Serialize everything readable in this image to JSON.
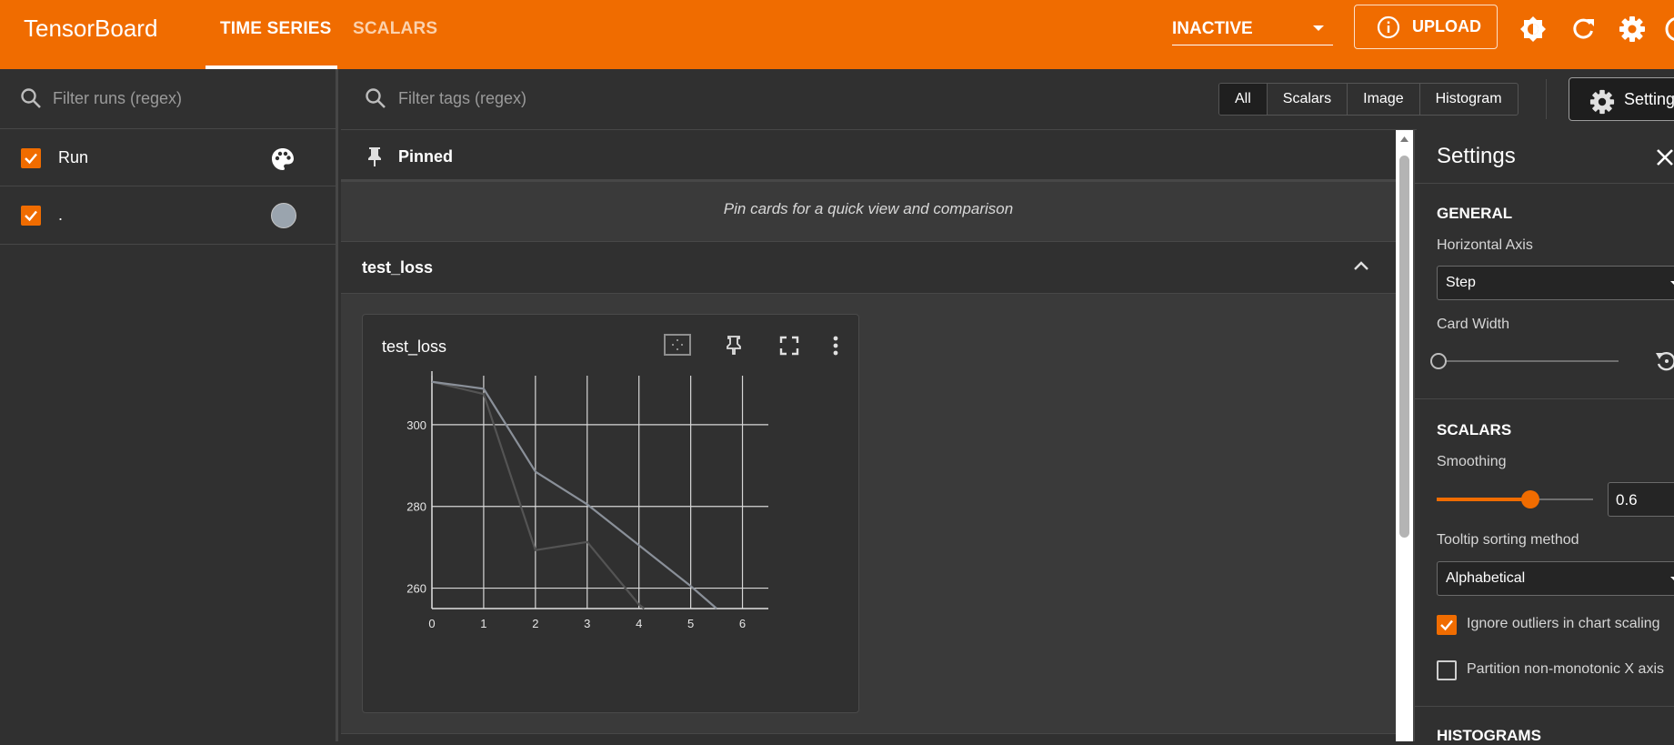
{
  "header": {
    "brand": "TensorBoard",
    "tabs": [
      {
        "label": "TIME SERIES",
        "active": true
      },
      {
        "label": "SCALARS",
        "active": false
      }
    ],
    "reload_selector": "INACTIVE",
    "upload_label": "UPLOAD",
    "accent_color": "#f06c00"
  },
  "runs_panel": {
    "filter_placeholder": "Filter runs (regex)",
    "items": [
      {
        "label": "Run",
        "checked": true,
        "icon": "palette-icon"
      },
      {
        "label": ".",
        "checked": true,
        "color": "#9aa4ae"
      }
    ]
  },
  "main": {
    "filter_placeholder": "Filter tags (regex)",
    "type_filters": [
      "All",
      "Scalars",
      "Image",
      "Histogram"
    ],
    "settings_button": "Settings",
    "pinned": {
      "title": "Pinned",
      "message": "Pin cards for a quick view and comparison"
    },
    "group": {
      "title": "test_loss"
    },
    "card": {
      "title": "test_loss"
    }
  },
  "chart_data": {
    "type": "line",
    "title": "test_loss",
    "xlabel": "",
    "ylabel": "",
    "x_ticks": [
      "0",
      "1",
      "2",
      "3",
      "4",
      "5",
      "6"
    ],
    "y_ticks": [
      "260",
      "280",
      "300"
    ],
    "xlim": [
      0,
      6.5
    ],
    "ylim": [
      255,
      312
    ],
    "grid": true,
    "series": [
      {
        "role": "smoothed",
        "color": "#8a9099",
        "x": [
          0,
          1,
          2,
          3,
          4,
          5,
          5.5
        ],
        "y": [
          310.5,
          308.8,
          288.5,
          280.5,
          270.5,
          260.5,
          255
        ]
      },
      {
        "role": "raw",
        "color": "#545454",
        "x": [
          0,
          1,
          2,
          3,
          4,
          4.1
        ],
        "y": [
          310.5,
          307.5,
          269.3,
          271.3,
          256,
          255
        ]
      }
    ]
  },
  "settings": {
    "title": "Settings",
    "general": {
      "heading": "GENERAL",
      "horizontal_axis_label": "Horizontal Axis",
      "horizontal_axis_value": "Step",
      "card_width_label": "Card Width"
    },
    "scalars": {
      "heading": "SCALARS",
      "smoothing_label": "Smoothing",
      "smoothing_value": "0.6",
      "smoothing": 0.6,
      "tooltip_label": "Tooltip sorting method",
      "tooltip_value": "Alphabetical",
      "ignore_outliers_label": "Ignore outliers in chart scaling",
      "ignore_outliers": true,
      "partition_label": "Partition non-monotonic X axis",
      "partition": false
    },
    "histograms": {
      "heading": "HISTOGRAMS"
    }
  }
}
